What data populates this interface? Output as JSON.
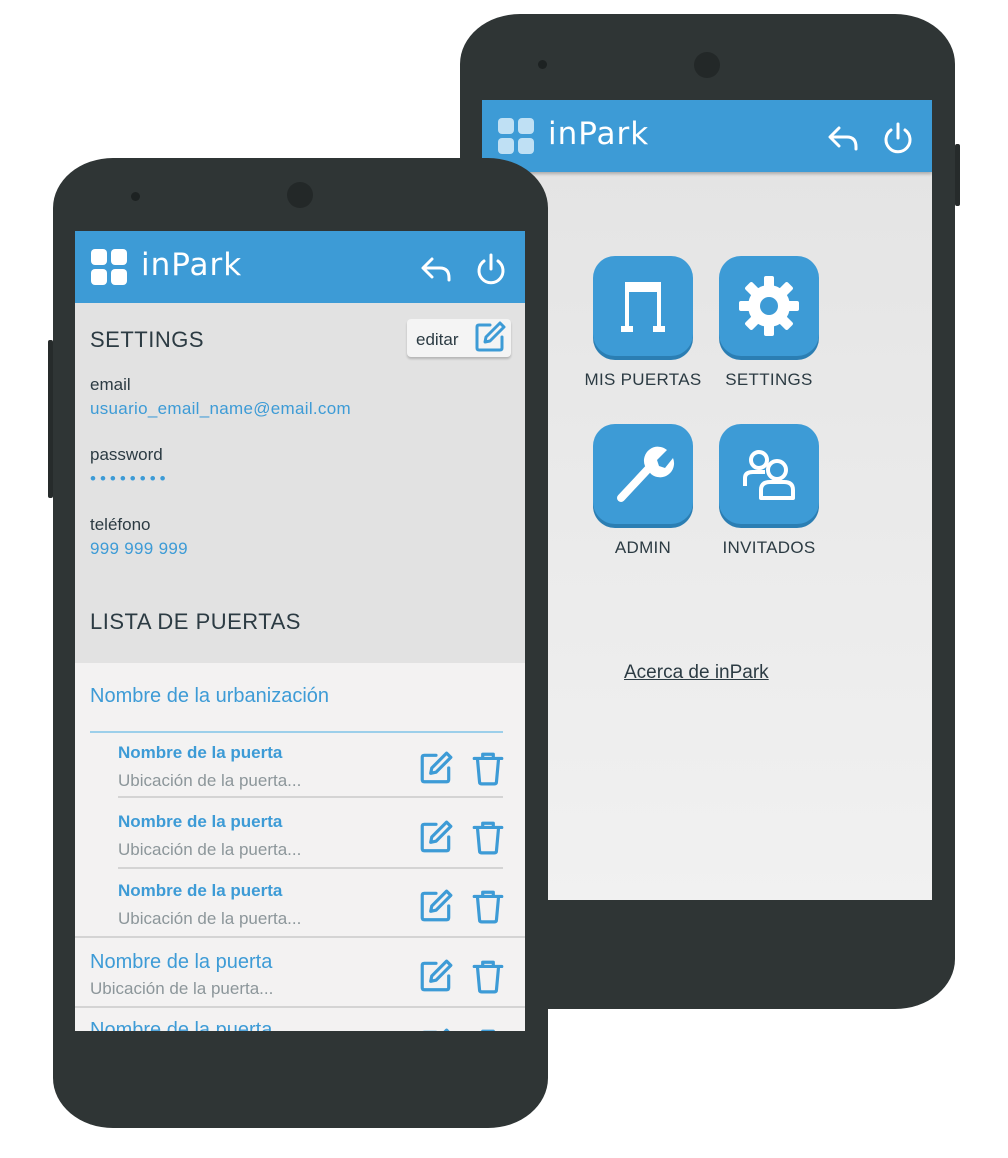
{
  "app": {
    "brand": "inPark"
  },
  "settings_screen": {
    "section_title": "SETTINGS",
    "edit_label": "editar",
    "fields": [
      {
        "label": "email",
        "value": "usuario_email_name@email.com"
      },
      {
        "label": "password",
        "value": "••••••••"
      },
      {
        "label": "teléfono",
        "value": "999 999 999"
      }
    ],
    "doors_section_title": "LISTA DE PUERTAS",
    "urbanization": "Nombre de la urbanización",
    "nested_doors": [
      {
        "name": "Nombre de la puerta",
        "location": "Ubicación de la puerta..."
      },
      {
        "name": "Nombre de la puerta",
        "location": "Ubicación de la puerta..."
      },
      {
        "name": "Nombre de la puerta",
        "location": "Ubicación de la puerta..."
      }
    ],
    "top_doors": [
      {
        "name": "Nombre de la puerta",
        "location": "Ubicación de la puerta..."
      },
      {
        "name": "Nombre de la puerta",
        "location": ""
      }
    ]
  },
  "home_screen": {
    "tiles": [
      {
        "label": "MIS PUERTAS",
        "icon": "door-icon"
      },
      {
        "label": "SETTINGS",
        "icon": "gear-icon"
      },
      {
        "label": "ADMIN",
        "icon": "wrench-icon"
      },
      {
        "label": "INVITADOS",
        "icon": "guests-icon"
      }
    ],
    "about_link": "Acerca de inPark"
  },
  "colors": {
    "accent": "#3d9bd6",
    "phone_body": "#2f3535",
    "text_dark": "#2c3b43"
  }
}
